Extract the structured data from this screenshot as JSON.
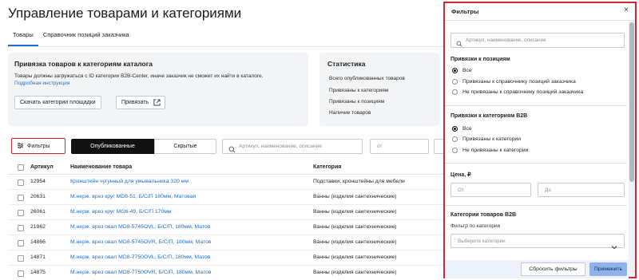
{
  "page": {
    "title": "Управление товарами и категориями",
    "tabs": [
      "Товары",
      "Справочник позиций заказчика"
    ]
  },
  "binding_card": {
    "title": "Привязка товаров к категориям каталога",
    "text": "Товары должны загружаться с ID категории B2B-Center, иначе заказчик не сможет их найти в каталоге.",
    "link": "Подробная инструкция",
    "download_label": "Скачать категории площадки",
    "bind_label": "Привязать"
  },
  "stats": {
    "title": "Статистика",
    "rows": [
      "Всего опубликованных товаров",
      "Привязаны к категориям",
      "Привязаны к позициям",
      "Наличие товаров"
    ]
  },
  "toolbar": {
    "filters_label": "Фильтры",
    "published_label": "Опубликованные",
    "hidden_label": "Скрытые",
    "search_placeholder": "Артикул, наименование, описание",
    "from_placeholder": "от"
  },
  "table": {
    "headers": [
      "Артикул",
      "Наименование товара",
      "Категория"
    ],
    "rows": [
      {
        "sku": "12954",
        "name": "Кронштейн чугунный для умывальника 320 мм",
        "category": "Подставки, кронштейны для мебели"
      },
      {
        "sku": "20631",
        "name": "М.нерж. врез круг MD8-51, Б/С/П 180мм, Матовая",
        "category": "Ванны (изделия сантехнические)"
      },
      {
        "sku": "26061",
        "name": "М.нерж. врез круг MG6-49, Б/С/П 170мм",
        "category": "Ванны (изделия сантехнические)"
      },
      {
        "sku": "21962",
        "name": "М.нерж. врез овал MD8-5745OVL, Б/С/П, 180мм, Матов",
        "category": "Ванны (изделия сантехнические)"
      },
      {
        "sku": "14866",
        "name": "М.нерж. врез овал MD8-5745OVR, Б/С/П, 180мм, Матов",
        "category": "Ванны (изделия сантехнические)"
      },
      {
        "sku": "14871",
        "name": "М.нерж. врез овал MD8-7750OVL, Б/С/П, 180мм, Матов",
        "category": "Ванны (изделия сантехнические)"
      },
      {
        "sku": "14875",
        "name": "М.нерж. врез овал MD8-7750OVR, Б/С/П, 180мм, Матов",
        "category": "Ванны (изделия сантехнические)"
      }
    ]
  },
  "filters_panel": {
    "title": "Фильтры",
    "close": "×",
    "search_placeholder": "Артикул, наименование, описание",
    "positions_title": "Привязки к позициям",
    "positions_options": [
      "Все",
      "Привязаны к справочнику позиций заказчика",
      "Не привязаны к справочнику позиций заказчика"
    ],
    "b2b_title": "Привязки к категориям B2B",
    "b2b_options": [
      "Все",
      "Привязаны к категории",
      "Не привязаны к категории"
    ],
    "price_title": "Цена, ₽",
    "price_from": "От",
    "price_to": "До",
    "categories_title": "Категории товаров B2B",
    "category_filter_label": "Фильтр по категории",
    "category_placeholder": "Выберите категории",
    "reset_label": "Сбросить фильтры",
    "apply_label": "Применить"
  },
  "colors": {
    "accent": "#1f6fd0",
    "highlight": "#d9232e",
    "apply_bg": "#8db3ea"
  }
}
